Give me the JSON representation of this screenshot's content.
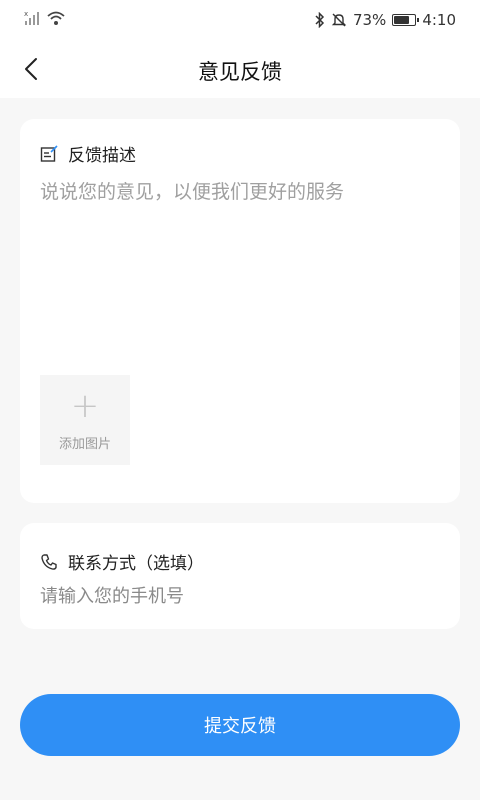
{
  "status_bar": {
    "battery_percent": "73%",
    "battery_level": 0.73,
    "time": "4:10",
    "icons": [
      "signal-icon",
      "wifi-icon",
      "bluetooth-icon",
      "mute-icon",
      "battery-icon"
    ]
  },
  "nav": {
    "title": "意见反馈",
    "back_icon": "chevron-left-icon"
  },
  "feedback": {
    "label": "反馈描述",
    "placeholder": "说说您的意见，以便我们更好的服务",
    "add_photo_label": "添加图片",
    "add_photo_icon": "plus-icon",
    "label_icon": "edit-note-icon"
  },
  "contact": {
    "label": "联系方式（选填）",
    "placeholder": "请输入您的手机号",
    "label_icon": "phone-icon"
  },
  "submit_label": "提交反馈",
  "colors": {
    "accent": "#2f8ff5",
    "background": "#f7f7f7",
    "card": "#ffffff"
  }
}
